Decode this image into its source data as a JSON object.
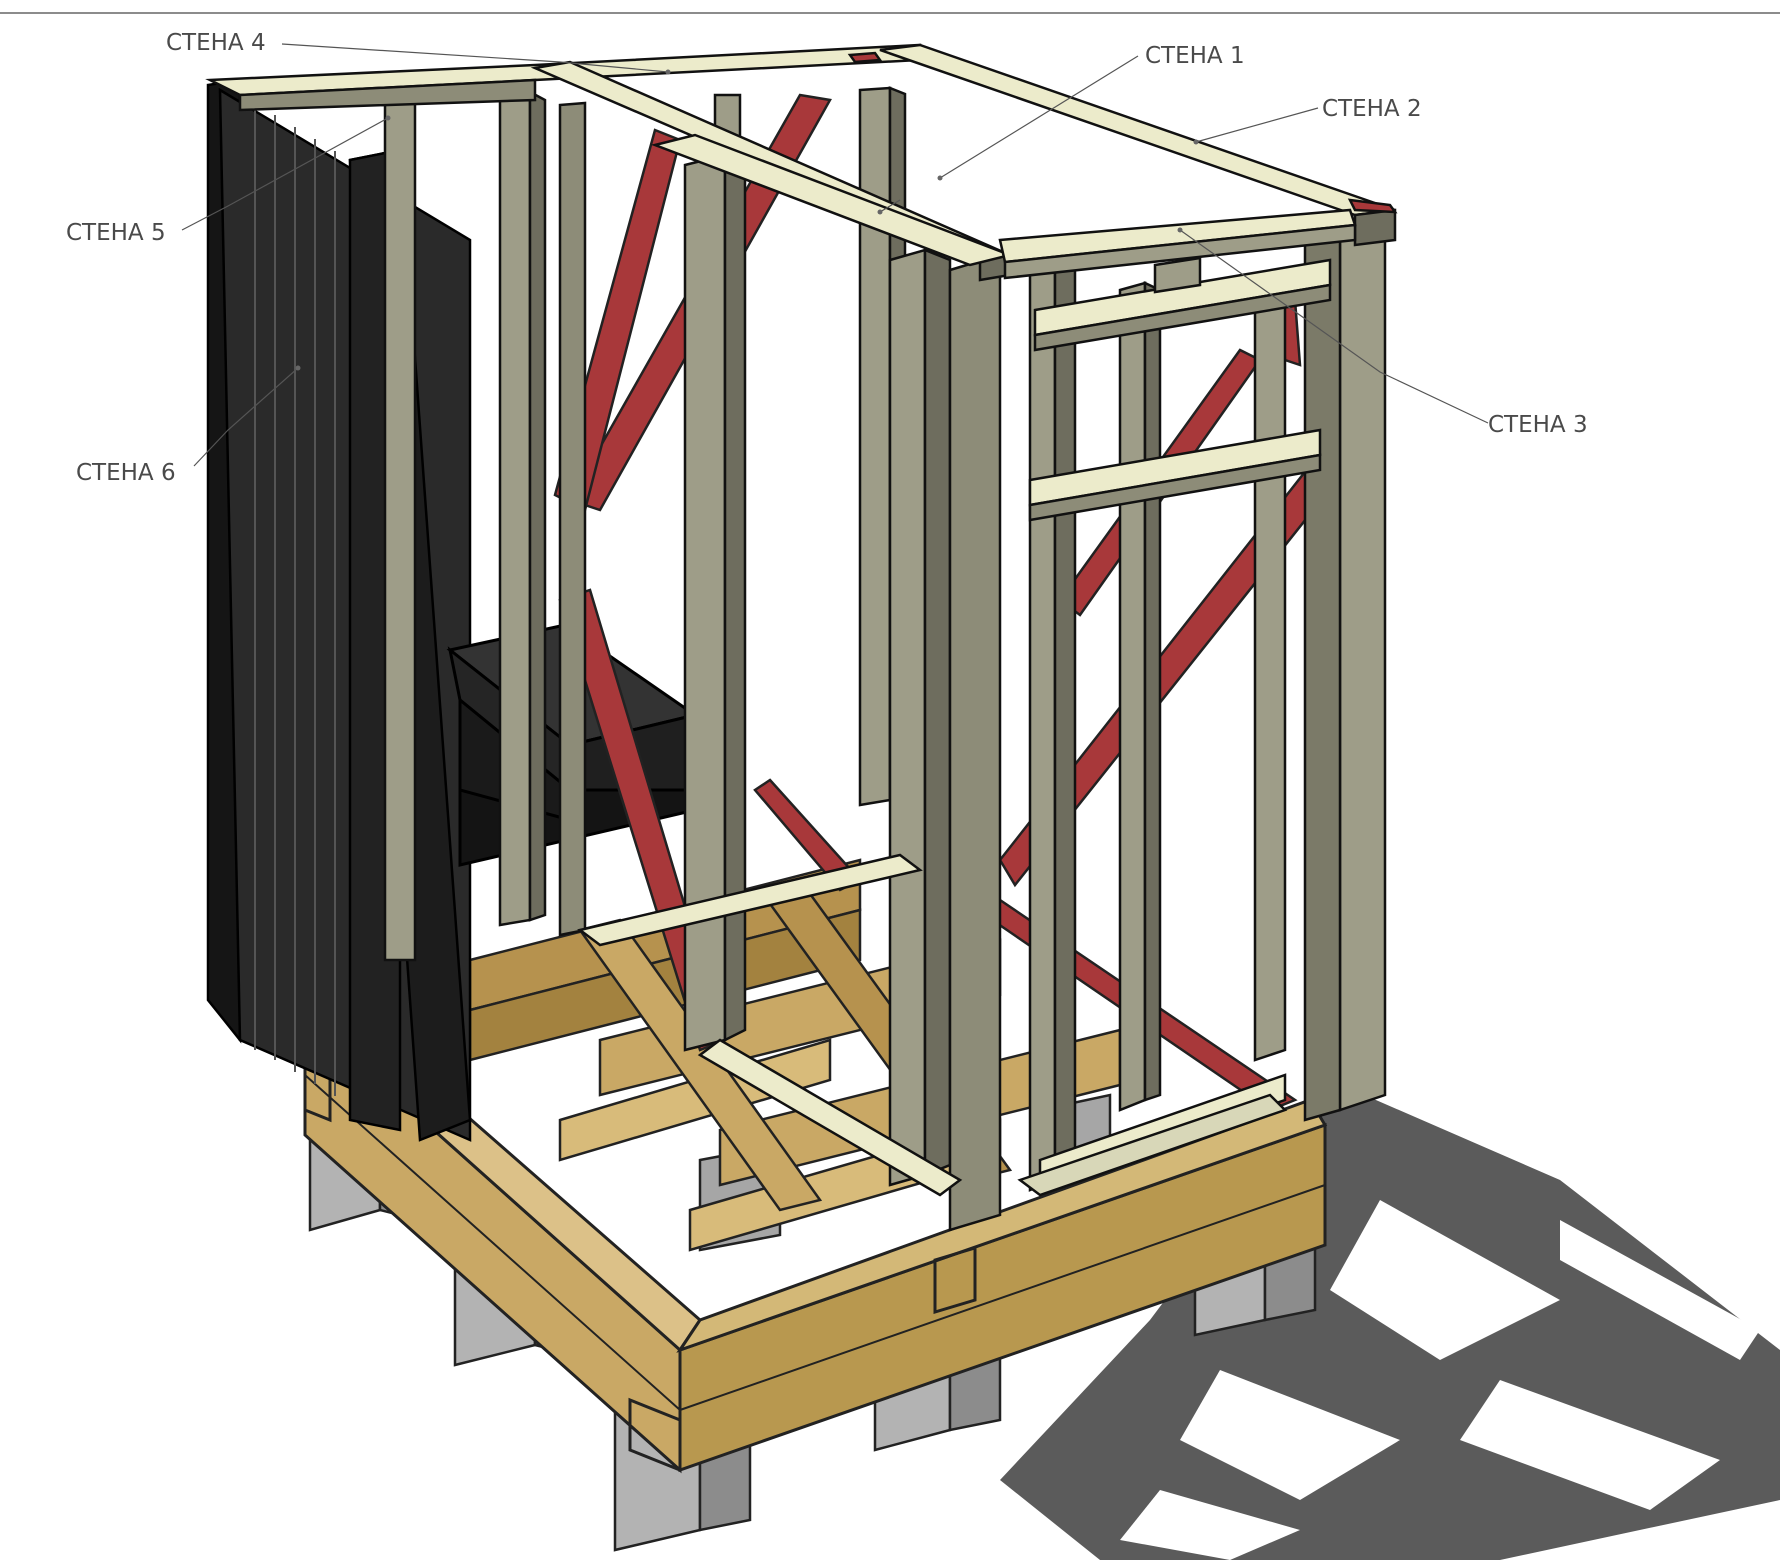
{
  "labels": {
    "wall1": "СТЕНА 1",
    "wall2": "СТЕНА 2",
    "wall3": "СТЕНА 3",
    "wall4": "СТЕНА 4",
    "wall5": "СТЕНА 5",
    "wall6": "СТЕНА 6"
  },
  "colors": {
    "timber": "#c9a865",
    "timber_dark": "#a3823f",
    "stud": "#9e9d88",
    "stud_dark": "#6e6d5e",
    "plate_top": "#ecebcb",
    "brace": "#a8383a",
    "panel": "#1e1e1e",
    "pier": "#a6a6a6",
    "shadow": "#5b5b5b"
  },
  "icons": {
    "label-dot": "small-dot-marker"
  }
}
